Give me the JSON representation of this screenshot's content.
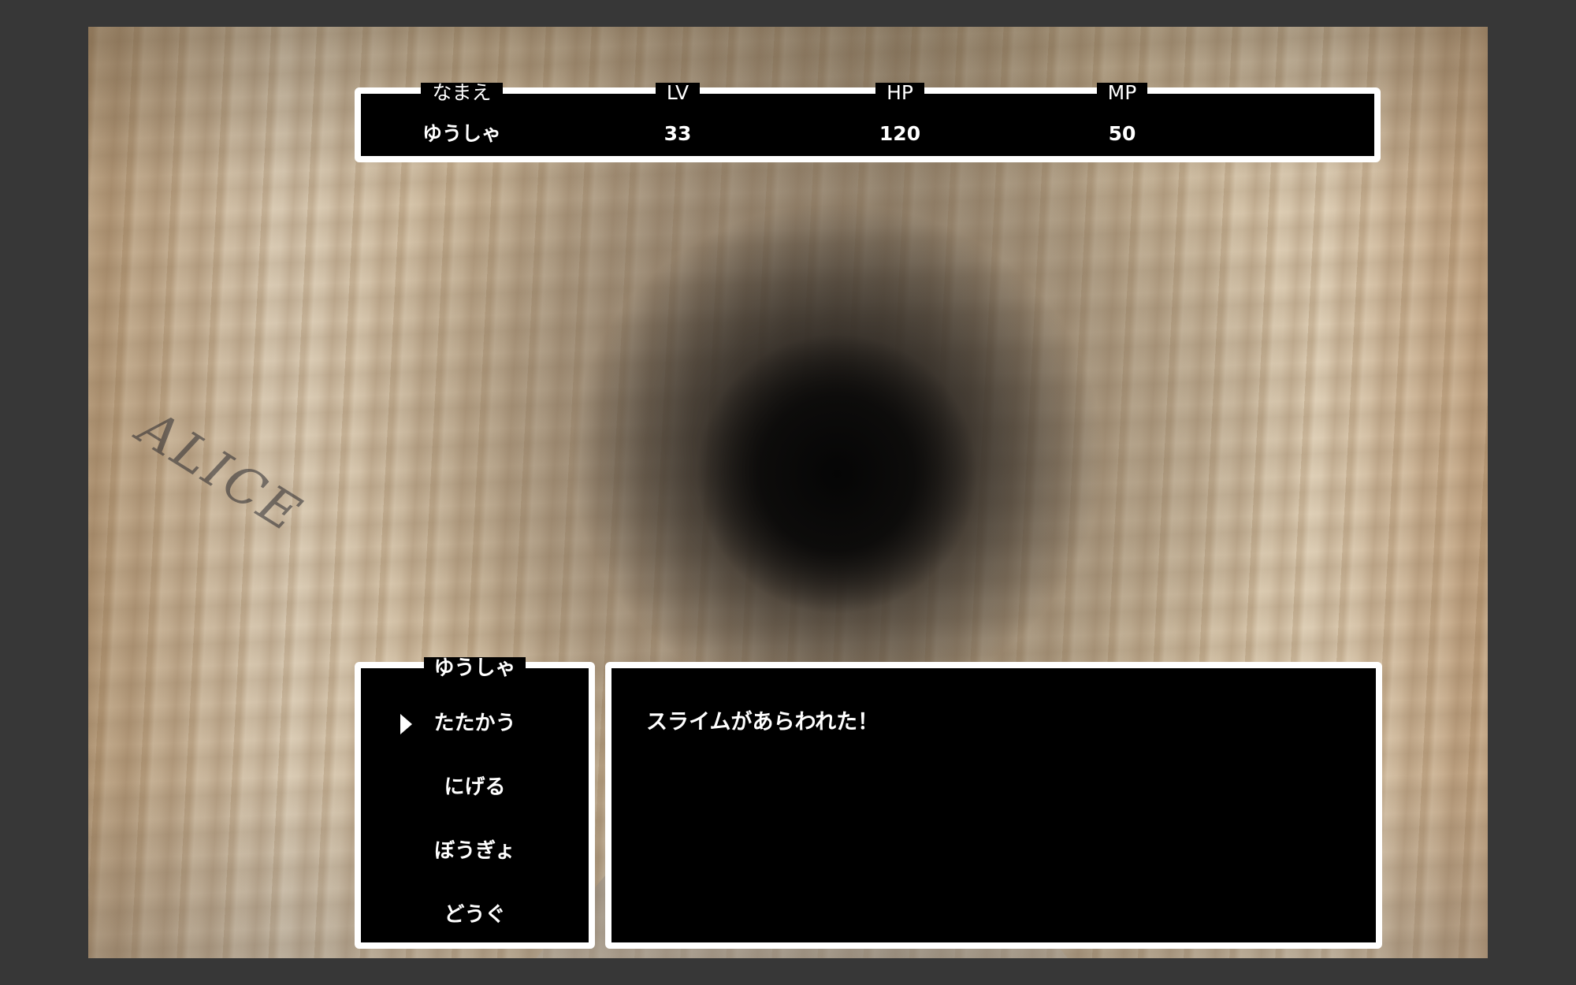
{
  "status": {
    "columns": [
      {
        "header": "なまえ",
        "value": "ゆうしゃ"
      },
      {
        "header": "LV",
        "value": "33"
      },
      {
        "header": "HP",
        "value": "120"
      },
      {
        "header": "MP",
        "value": "50"
      }
    ]
  },
  "command": {
    "title": "ゆうしゃ",
    "items": [
      "たたかう",
      "にげる",
      "ぼうぎょ",
      "どうぐ"
    ],
    "selected_index": 0
  },
  "message": {
    "text": "スライムがあらわれた！"
  },
  "scene": {
    "background": "rocky tunnel",
    "graffiti": "ALICE"
  },
  "colors": {
    "window_bg": "#000000",
    "window_border": "#ffffff",
    "text": "#ffffff",
    "app_bg": "#373737"
  }
}
